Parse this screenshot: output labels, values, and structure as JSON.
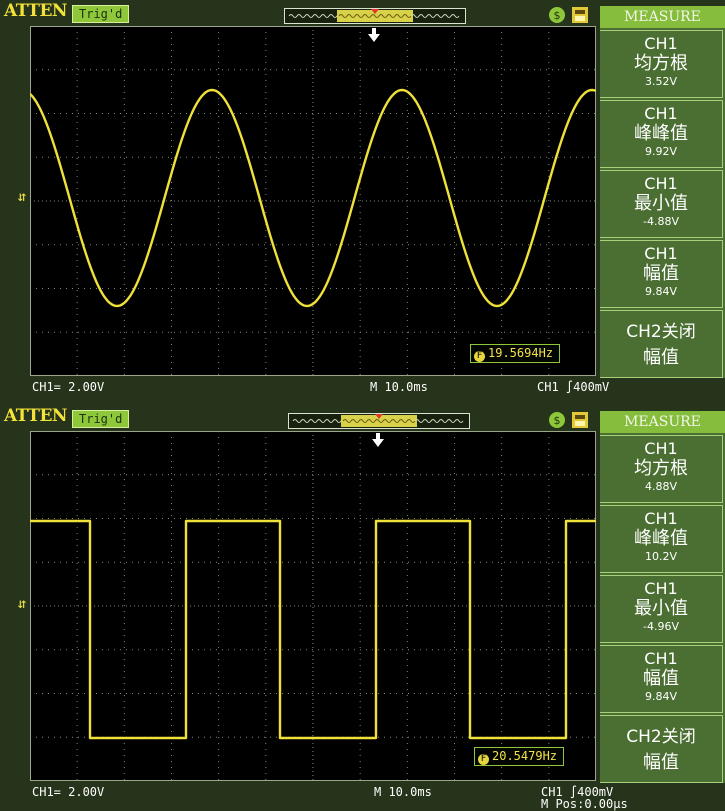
{
  "panels": [
    {
      "brand": "ATTEN",
      "trigger_status": "Trig'd",
      "measure_title": "MEASURE",
      "measurements": [
        {
          "channel": "CH1",
          "name": "均方根",
          "value": "3.52V"
        },
        {
          "channel": "CH1",
          "name": "峰峰值",
          "value": "9.92V"
        },
        {
          "channel": "CH1",
          "name": "最小值",
          "value": "-4.88V"
        },
        {
          "channel": "CH1",
          "name": "幅值",
          "value": "9.84V"
        }
      ],
      "extra_line1": "CH2关闭",
      "extra_line2": "幅值",
      "frequency": "19.5694Hz",
      "freq_icon": "F",
      "ch1_scale": "CH1= 2.00V",
      "timebase": "M 10.0ms",
      "trigger_level": "CH1 ∫400mV",
      "mpos": "",
      "waveform": "sine",
      "trace_color": "#efe13a"
    },
    {
      "brand": "ATTEN",
      "trigger_status": "Trig'd",
      "measure_title": "MEASURE",
      "measurements": [
        {
          "channel": "CH1",
          "name": "均方根",
          "value": "4.88V"
        },
        {
          "channel": "CH1",
          "name": "峰峰值",
          "value": "10.2V"
        },
        {
          "channel": "CH1",
          "name": "最小值",
          "value": "-4.96V"
        },
        {
          "channel": "CH1",
          "name": "幅值",
          "value": "9.84V"
        }
      ],
      "extra_line1": "CH2关闭",
      "extra_line2": "幅值",
      "frequency": "20.5479Hz",
      "freq_icon": "F",
      "ch1_scale": "CH1= 2.00V",
      "timebase": "M 10.0ms",
      "trigger_level": "CH1 ∫400mV",
      "mpos": "M Pos:0.00μs",
      "waveform": "square",
      "trace_color": "#efe13a"
    }
  ]
}
